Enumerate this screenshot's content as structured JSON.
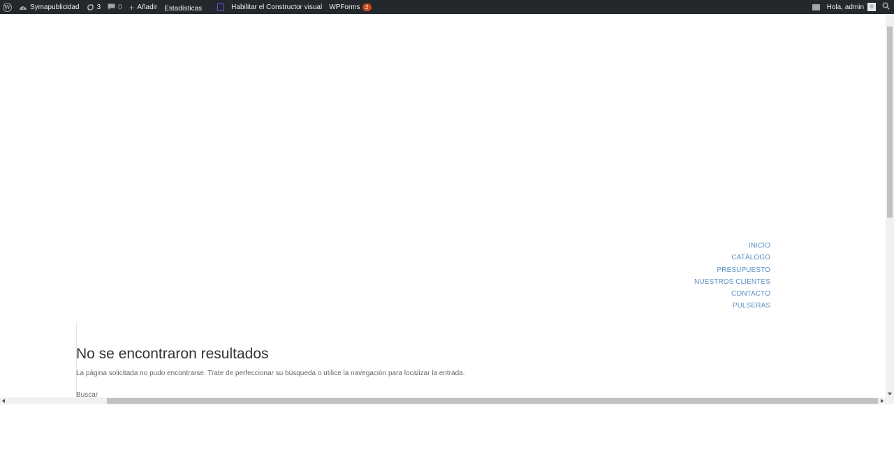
{
  "adminbar": {
    "site_name": "Symapublicidad",
    "updates_count": "3",
    "comments_count": "0",
    "add_new_label": "Añadir",
    "stats_alt": "Estadísticas",
    "visual_builder_label": "Habilitar el Constructor visual",
    "wpforms_label": "WPForms",
    "wpforms_count": "2",
    "greeting": "Hola, admin",
    "colors": {
      "background": "#23282d",
      "badge": "#ca4a1f",
      "divi": "#6c4ad0"
    }
  },
  "nav": {
    "items": [
      "INICIO",
      "CATÁLOGO",
      "PRESUPUESTO",
      "NUESTROS CLIENTES",
      "CONTACTO",
      "PULSERAS"
    ],
    "color": "#5b8fc4"
  },
  "content": {
    "title": "No se encontraron resultados",
    "message": "La página solicitada no pudo encontrarse. Trate de perfeccionar su búsqueda o utilice la navegación para localizar la entrada.",
    "search_label": "Buscar"
  }
}
